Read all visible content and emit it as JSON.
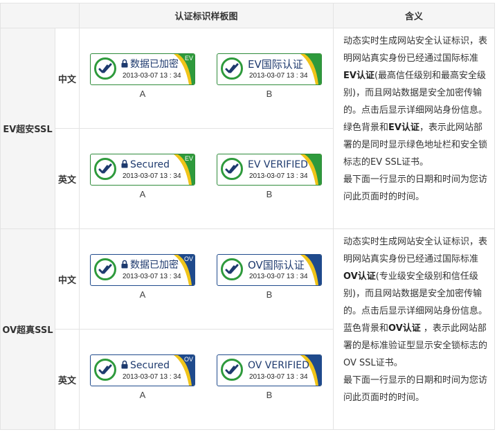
{
  "header": {
    "col_sample": "认证标识样板图",
    "col_meaning": "含义"
  },
  "sections": [
    {
      "category": "EV超安SSL",
      "type": "ev",
      "rows": [
        {
          "lang": "中文",
          "a_title": "数据已加密",
          "b_title": "EV国际认证",
          "tag": "EV",
          "date": "2013-03-07 13 : 34",
          "a_label": "A",
          "b_label": "B"
        },
        {
          "lang": "英文",
          "a_title": "Secured",
          "b_title": "EV VERIFIED",
          "tag": "EV",
          "date": "2013-03-07 13 : 34",
          "a_label": "A",
          "b_label": "B"
        }
      ],
      "desc": {
        "p1_a": "动态实时生成网站安全认证标识，表明网站真实身份已经通过国际标准",
        "p1_b": "EV认证",
        "p1_c": "(最高信任级别和最高安全级别)，而且网站数据是安全加密传输的。点击后显示详细网站身份信息。",
        "p2_a": "绿色背景和",
        "p2_b": "EV认证",
        "p2_c": "，表示此网站部署的是同时显示绿色地址栏和安全锁标志的EV SSL证书。",
        "p3": "最下面一行显示的日期和时间为您访问此页面时的时间。"
      }
    },
    {
      "category": "OV超真SSL",
      "type": "ov",
      "rows": [
        {
          "lang": "中文",
          "a_title": "数据已加密",
          "b_title": "OV国际认证",
          "tag": "OV",
          "date": "2013-03-07 13 : 34",
          "a_label": "A",
          "b_label": "B"
        },
        {
          "lang": "英文",
          "a_title": "Secured",
          "b_title": "OV VERIFIED",
          "tag": "OV",
          "date": "2013-03-07 13 : 34",
          "a_label": "A",
          "b_label": "B"
        }
      ],
      "desc": {
        "p1_a": "动态实时生成网站安全认证标识，表明网站真实身份已经通过国际标准",
        "p1_b": "OV认证",
        "p1_c": "(专业级安全级别和信任级别)，而且网站数据是安全加密传输的。点击后显示详细网站身份信息。",
        "p2_a": "蓝色背景和",
        "p2_b": "OV认证",
        "p2_c": " ，表示此网站部署的是标准验证型显示安全锁标志的OV SSL证书。",
        "p3": "最下面一行显示的日期和时间为您访问此页面时的时间。"
      }
    }
  ],
  "colors": {
    "ev_green": "#2e9a3c",
    "ev_yellow": "#f0c419",
    "ov_blue": "#1f4a8c",
    "title_navy": "#1e3a6e"
  }
}
